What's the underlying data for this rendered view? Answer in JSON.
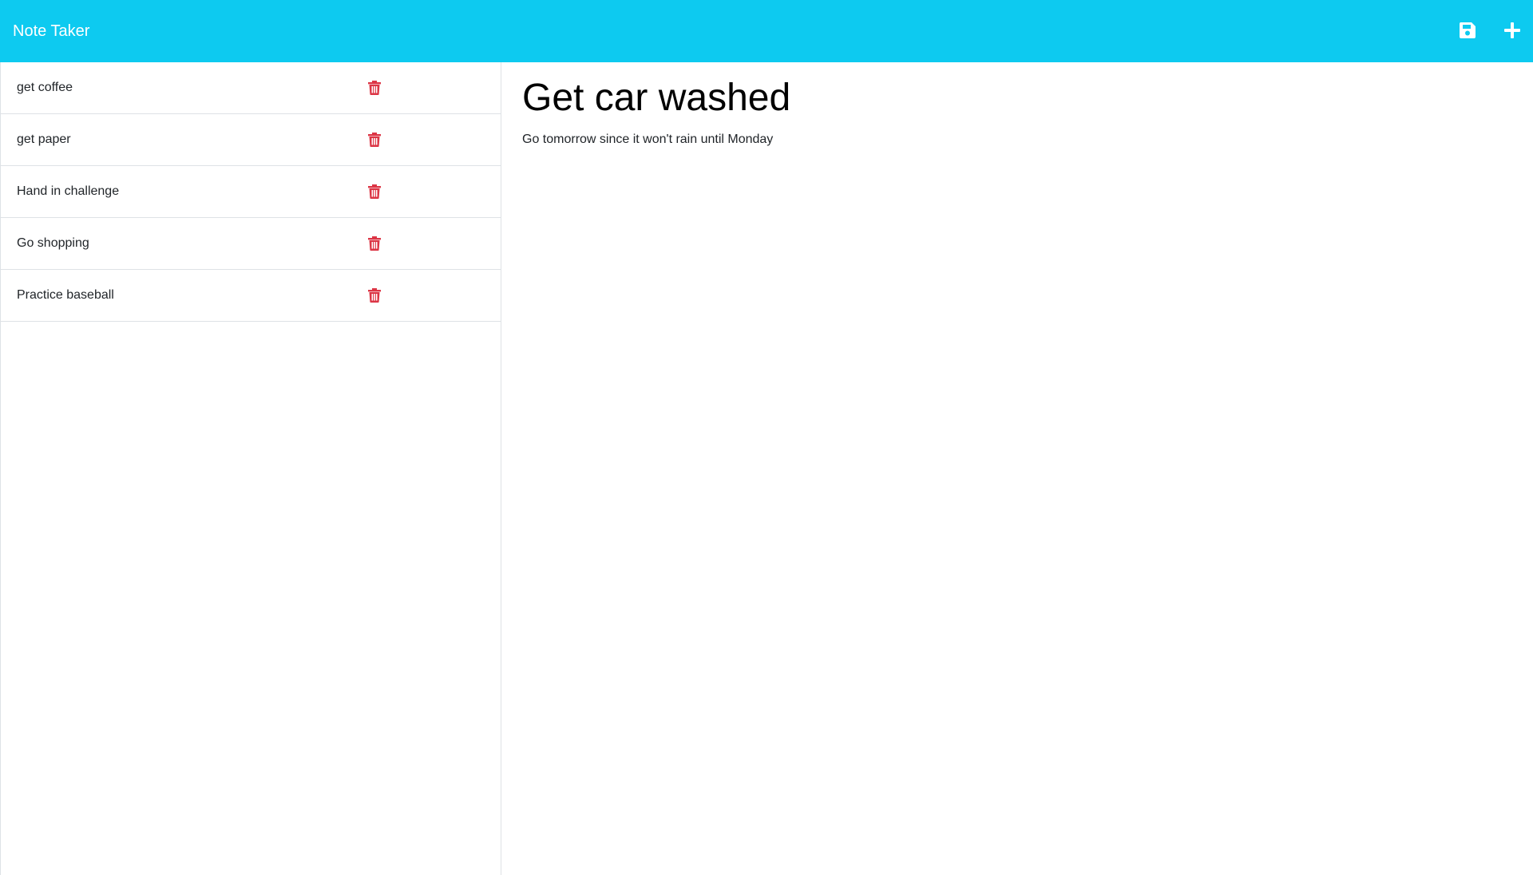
{
  "app": {
    "title": "Note Taker",
    "accent_color": "#0dcaf0",
    "delete_color": "#dc3545"
  },
  "header": {
    "save_icon": "save-icon",
    "add_icon": "plus-icon"
  },
  "notes": [
    {
      "title": "get coffee"
    },
    {
      "title": "get paper"
    },
    {
      "title": "Hand in challenge"
    },
    {
      "title": "Go shopping"
    },
    {
      "title": "Practice baseball"
    }
  ],
  "active_note": {
    "title": "Get car washed",
    "text": "Go tomorrow since it won't rain until Monday"
  }
}
